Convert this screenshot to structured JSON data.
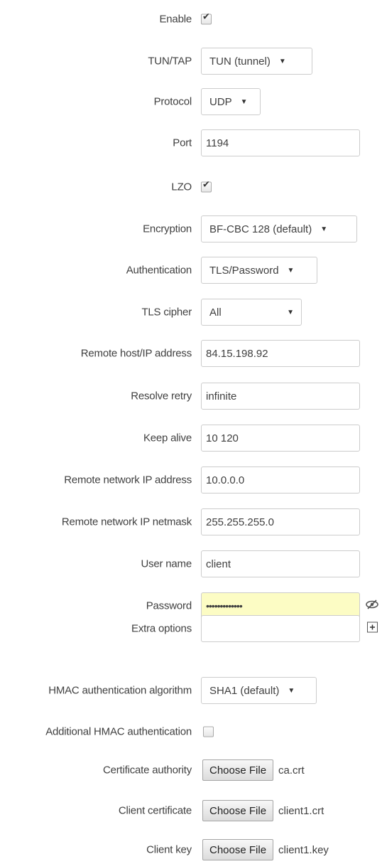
{
  "fields": {
    "enable": {
      "label": "Enable",
      "checked": true
    },
    "tuntap": {
      "label": "TUN/TAP",
      "value": "TUN (tunnel)"
    },
    "protocol": {
      "label": "Protocol",
      "value": "UDP"
    },
    "port": {
      "label": "Port",
      "value": "1194"
    },
    "lzo": {
      "label": "LZO",
      "checked": true
    },
    "encryption": {
      "label": "Encryption",
      "value": "BF-CBC 128 (default)"
    },
    "authentication": {
      "label": "Authentication",
      "value": "TLS/Password"
    },
    "tls_cipher": {
      "label": "TLS cipher",
      "value": "All"
    },
    "remote_host": {
      "label": "Remote host/IP address",
      "value": "84.15.198.92"
    },
    "resolve_retry": {
      "label": "Resolve retry",
      "value": "infinite"
    },
    "keep_alive": {
      "label": "Keep alive",
      "value": "10 120"
    },
    "remote_net_ip": {
      "label": "Remote network IP address",
      "value": "10.0.0.0"
    },
    "remote_net_mask": {
      "label": "Remote network IP netmask",
      "value": "255.255.255.0"
    },
    "user_name": {
      "label": "User name",
      "value": "client"
    },
    "password": {
      "label": "Password",
      "value": "•••••••••••••"
    },
    "extra_options": {
      "label": "Extra options",
      "value": ""
    },
    "hmac_algo": {
      "label": "HMAC authentication algorithm",
      "value": "SHA1 (default)"
    },
    "additional_hmac": {
      "label": "Additional HMAC authentication",
      "checked": false
    },
    "ca": {
      "label": "Certificate authority",
      "button": "Choose File",
      "file": "ca.crt"
    },
    "client_cert": {
      "label": "Client certificate",
      "button": "Choose File",
      "file": "client1.crt"
    },
    "client_key": {
      "label": "Client key",
      "button": "Choose File",
      "file": "client1.key"
    }
  },
  "icons": {
    "select_arrow": "▼",
    "checkmark": "✔",
    "password_toggle": "eye-slash-icon",
    "extra_options_add": "expand-icon"
  }
}
